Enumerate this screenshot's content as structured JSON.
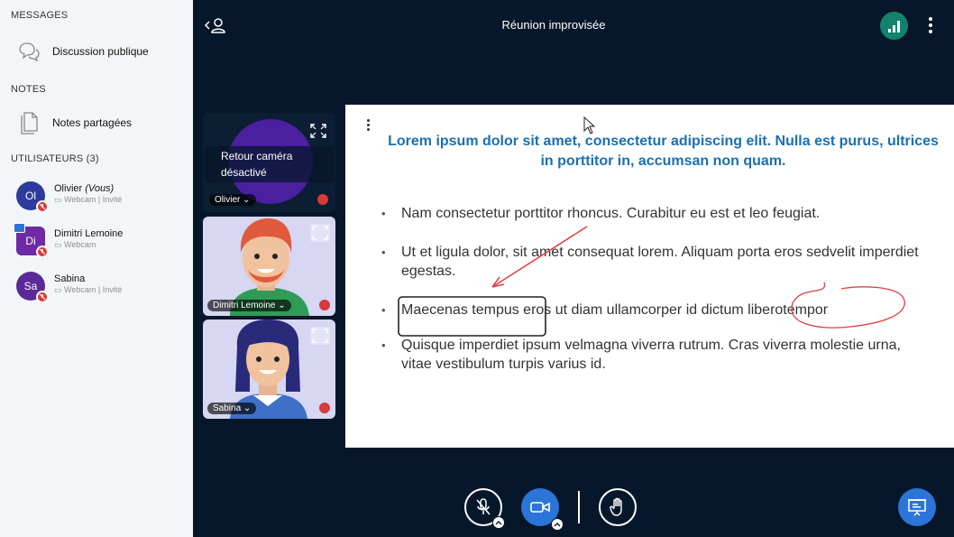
{
  "sidebar": {
    "messages_header": "MESSAGES",
    "public_chat": "Discussion publique",
    "notes_header": "NOTES",
    "shared_notes": "Notes partagées",
    "users_header": "UTILISATEURS (3)",
    "users": [
      {
        "initials": "Ol",
        "name": "Olivier",
        "suffix": "(Vous)",
        "status": "Webcam | Invité",
        "color": "#2e3b9c"
      },
      {
        "initials": "Di",
        "name": "Dimitri Lemoine",
        "suffix": "",
        "status": "Webcam",
        "color": "#6f2aa6"
      },
      {
        "initials": "Sa",
        "name": "Sabina",
        "suffix": "",
        "status": "Webcam | Invité",
        "color": "#5b2a96"
      }
    ]
  },
  "header": {
    "title": "Réunion improvisée"
  },
  "videos": [
    {
      "name": "Olivier",
      "overlay": "Retour caméra désactivé"
    },
    {
      "name": "Dimitri Lemoine"
    },
    {
      "name": "Sabina"
    }
  ],
  "slide": {
    "title": "Lorem ipsum dolor sit amet, consectetur adipiscing elit. Nulla est purus, ultrices in porttitor in, accumsan non quam.",
    "bullets": [
      "Nam consectetur porttitor rhoncus. Curabitur eu est et leo feugiat.",
      "Ut et ligula dolor, sit amet consequat lorem. Aliquam porta eros sedvelit imperdiet egestas.",
      "Maecenas tempus eros ut diam ullamcorper id dictum liberotempor",
      "Quisque imperdiet ipsum velmagna viverra rutrum. Cras viverra molestie urna, vitae vestibulum turpis varius id."
    ]
  },
  "icons": {
    "back": "person-back-icon",
    "connection": "signal-bars-icon",
    "more": "kebab-menu-icon",
    "mic": "mic-muted-icon",
    "camera": "video-camera-icon",
    "hand": "raise-hand-icon",
    "presentation": "presentation-screen-icon"
  },
  "colors": {
    "background": "#06172b",
    "sidebar": "#f3f6f9",
    "accent": "#2c75d8",
    "connection": "#12826d",
    "slide_title": "#1a6fb5",
    "muted": "#d93a3a"
  }
}
